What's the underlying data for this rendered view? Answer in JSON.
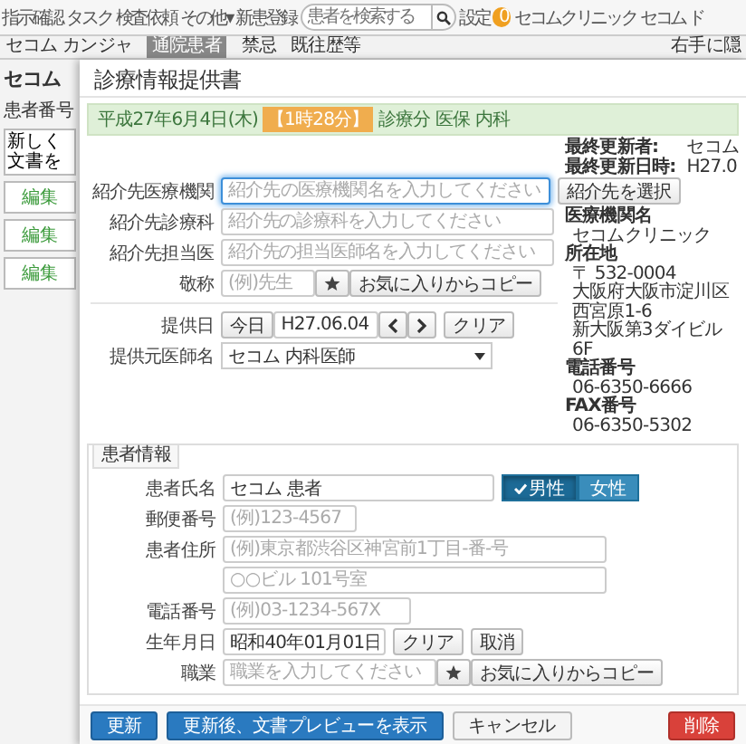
{
  "nav": {
    "items": [
      {
        "label": "指示確認"
      },
      {
        "label": "タスク"
      },
      {
        "label": "検査依頼"
      },
      {
        "label": "その他▾"
      },
      {
        "label": "新患登録"
      }
    ],
    "search": {
      "placeholder": "患者を検索する"
    },
    "settings": {
      "label": "設定",
      "badge": "0"
    },
    "clinic": "セコムクリニック",
    "user": "セコム ド"
  },
  "patient_bar": {
    "name": "セコム カンジャ",
    "status": "通院患者",
    "tabs": [
      {
        "label": "禁忌"
      },
      {
        "label": "既往歴等"
      }
    ],
    "right": "右手に隠"
  },
  "sidebar": {
    "name": "セコム",
    "id_label": "患者番号",
    "new_doc": "新しく文書を",
    "edit_buttons": [
      "編集",
      "編集",
      "編集"
    ]
  },
  "dialog": {
    "title": "診療情報提供書",
    "alert": {
      "date": "平成27年6月4日(木)",
      "time": "【1時28分】",
      "text": "診療分 医保 内科"
    },
    "meta": [
      {
        "label": "最終更新者:",
        "value": "セコム"
      },
      {
        "label": "最終更新日時:",
        "value": "H27.0"
      }
    ],
    "referral_fields": [
      {
        "kind": "text_button",
        "label": "紹介先医療機関",
        "placeholder": "紹介先の医療機関名を入力してください",
        "button": "紹介先を選択",
        "focused": true
      },
      {
        "kind": "text",
        "label": "紹介先診療科",
        "placeholder": "紹介先の診療科を入力してください"
      },
      {
        "kind": "text",
        "label": "紹介先担当医",
        "placeholder": "紹介先の担当医師名を入力してください"
      },
      {
        "kind": "favorite",
        "label": "敬称",
        "placeholder": "(例)先生",
        "button": "お気に入りからコピー"
      }
    ],
    "provision_fields": [
      {
        "kind": "date",
        "label": "提供日",
        "today": "今日",
        "value": "H27.06.04",
        "clear": "クリア"
      },
      {
        "kind": "select",
        "label": "提供元医師名",
        "value": "セコム 内科医師"
      }
    ],
    "clinic_info": [
      {
        "heading": "医療機関名",
        "lines": [
          "セコムクリニック"
        ]
      },
      {
        "heading": "所在地",
        "lines": [
          "〒 532-0004",
          "大阪府大阪市淀川区西宮原1-6",
          "新大阪第3ダイビル 6F"
        ]
      },
      {
        "heading": "電話番号",
        "lines": [
          "06-6350-6666"
        ]
      },
      {
        "heading": "FAX番号",
        "lines": [
          "06-6350-5302"
        ]
      }
    ],
    "patient_section": {
      "title": "患者情報",
      "fields": [
        {
          "kind": "name",
          "label": "患者氏名",
          "value": "セコム 患者",
          "genders": [
            {
              "label": "男性",
              "selected": true
            },
            {
              "label": "女性",
              "selected": false
            }
          ]
        },
        {
          "kind": "postal",
          "label": "郵便番号",
          "placeholder": "(例)123-4567"
        },
        {
          "kind": "address",
          "label": "患者住所",
          "placeholders": [
            "(例)東京都渋谷区神宮前1丁目-番-号",
            "○○ビル 101号室"
          ]
        },
        {
          "kind": "phone",
          "label": "電話番号",
          "placeholder": "(例)03-1234-567X"
        },
        {
          "kind": "birth",
          "label": "生年月日",
          "value": "昭和40年01月01日",
          "buttons": [
            "クリア",
            "取消"
          ]
        },
        {
          "kind": "favorite",
          "label": "職業",
          "placeholder": "職業を入力してください",
          "button": "お気に入りからコピー"
        }
      ]
    },
    "footer_buttons": [
      {
        "label": "更新",
        "kind": "primary"
      },
      {
        "label": "更新後、文書プレビューを表示",
        "kind": "primary"
      },
      {
        "label": "キャンセル",
        "kind": "default"
      },
      {
        "label": "削除",
        "kind": "danger"
      }
    ]
  }
}
